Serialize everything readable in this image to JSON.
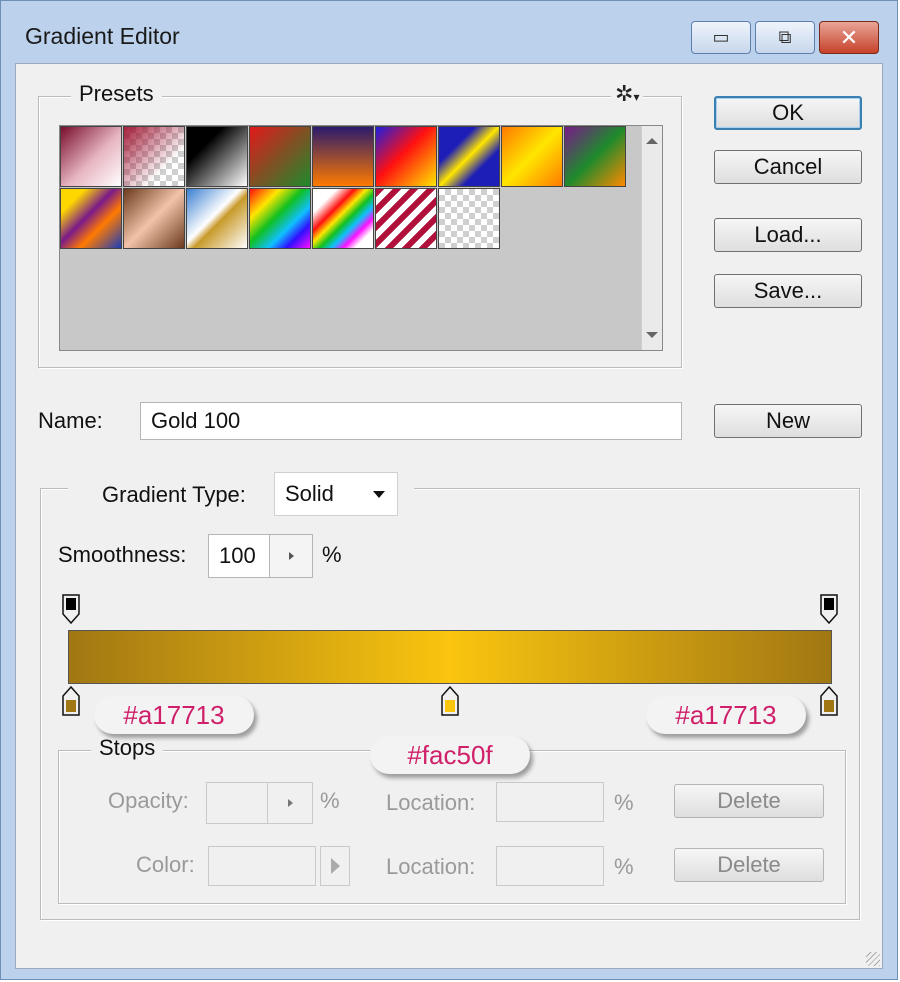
{
  "window": {
    "title": "Gradient Editor",
    "min_glyph": "▭",
    "restore_glyph": "⧉",
    "close_glyph": "✕"
  },
  "presets": {
    "label": "Presets",
    "menu_glyph": "✲",
    "menu_arrow": "▾"
  },
  "buttons": {
    "ok": "OK",
    "cancel": "Cancel",
    "load": "Load...",
    "save": "Save...",
    "new": "New"
  },
  "name": {
    "label": "Name:",
    "value": "Gold 100"
  },
  "gradient_type": {
    "label": "Gradient Type:",
    "value": "Solid"
  },
  "smoothness": {
    "label": "Smoothness:",
    "value": "100",
    "unit": "%"
  },
  "colors": {
    "gold_dark": "#a17713",
    "gold_light": "#fac50f",
    "accent": "#d0206a"
  },
  "callouts": {
    "left": "#a17713",
    "center": "#fac50f",
    "right": "#a17713"
  },
  "stops": {
    "label": "Stops",
    "opacity_label": "Opacity:",
    "opacity_unit": "%",
    "color_label": "Color:",
    "location_label_1": "Location:",
    "location_unit_1": "%",
    "location_label_2": "Location:",
    "location_unit_2": "%",
    "delete_1": "Delete",
    "delete_2": "Delete"
  }
}
